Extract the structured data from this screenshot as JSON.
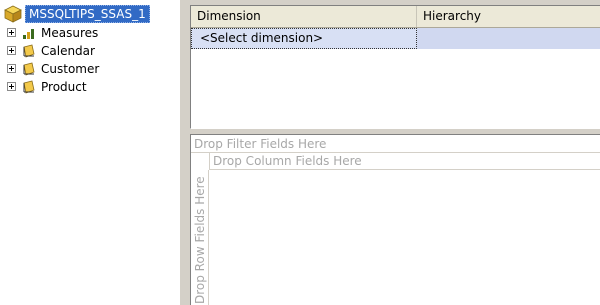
{
  "tree": {
    "root_label": "MSSQLTIPS_SSAS_1",
    "root_icon": "cube-icon",
    "items": [
      {
        "label": "Measures",
        "icon": "measures-bar-icon"
      },
      {
        "label": "Calendar",
        "icon": "dimension-icon"
      },
      {
        "label": "Customer",
        "icon": "dimension-icon"
      },
      {
        "label": "Product",
        "icon": "dimension-icon"
      }
    ]
  },
  "filter_grid": {
    "columns": [
      "Dimension",
      "Hierarchy"
    ],
    "rows": [
      {
        "dimension": "<Select dimension>",
        "hierarchy": ""
      }
    ]
  },
  "pivot": {
    "drop_filter": "Drop Filter Fields Here",
    "drop_column": "Drop Column Fields Here",
    "drop_row": "Drop Row Fields Here"
  },
  "colors": {
    "selection": "#316ac5",
    "panel": "#d4d0c8",
    "hint_text": "#a8a8a8",
    "row_highlight": "#d8e0f4"
  }
}
